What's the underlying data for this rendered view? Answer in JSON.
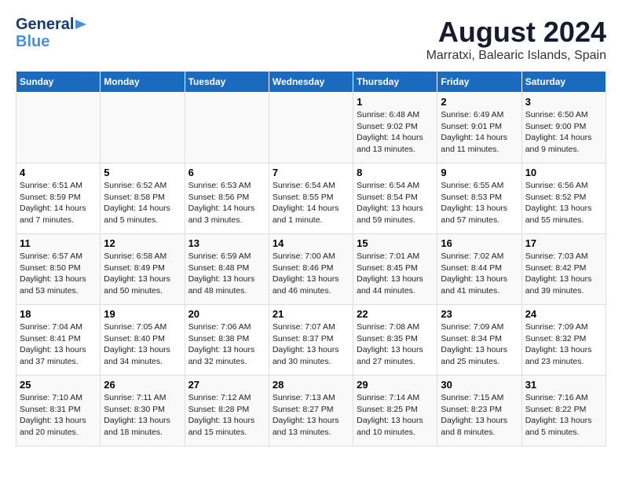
{
  "header": {
    "logo_line1": "General",
    "logo_line2": "Blue",
    "main_title": "August 2024",
    "subtitle": "Marratxi, Balearic Islands, Spain"
  },
  "days_of_week": [
    "Sunday",
    "Monday",
    "Tuesday",
    "Wednesday",
    "Thursday",
    "Friday",
    "Saturday"
  ],
  "weeks": [
    [
      {
        "day": "",
        "info": ""
      },
      {
        "day": "",
        "info": ""
      },
      {
        "day": "",
        "info": ""
      },
      {
        "day": "",
        "info": ""
      },
      {
        "day": "1",
        "info": "Sunrise: 6:48 AM\nSunset: 9:02 PM\nDaylight: 14 hours\nand 13 minutes."
      },
      {
        "day": "2",
        "info": "Sunrise: 6:49 AM\nSunset: 9:01 PM\nDaylight: 14 hours\nand 11 minutes."
      },
      {
        "day": "3",
        "info": "Sunrise: 6:50 AM\nSunset: 9:00 PM\nDaylight: 14 hours\nand 9 minutes."
      }
    ],
    [
      {
        "day": "4",
        "info": "Sunrise: 6:51 AM\nSunset: 8:59 PM\nDaylight: 14 hours\nand 7 minutes."
      },
      {
        "day": "5",
        "info": "Sunrise: 6:52 AM\nSunset: 8:58 PM\nDaylight: 14 hours\nand 5 minutes."
      },
      {
        "day": "6",
        "info": "Sunrise: 6:53 AM\nSunset: 8:56 PM\nDaylight: 14 hours\nand 3 minutes."
      },
      {
        "day": "7",
        "info": "Sunrise: 6:54 AM\nSunset: 8:55 PM\nDaylight: 14 hours\nand 1 minute."
      },
      {
        "day": "8",
        "info": "Sunrise: 6:54 AM\nSunset: 8:54 PM\nDaylight: 13 hours\nand 59 minutes."
      },
      {
        "day": "9",
        "info": "Sunrise: 6:55 AM\nSunset: 8:53 PM\nDaylight: 13 hours\nand 57 minutes."
      },
      {
        "day": "10",
        "info": "Sunrise: 6:56 AM\nSunset: 8:52 PM\nDaylight: 13 hours\nand 55 minutes."
      }
    ],
    [
      {
        "day": "11",
        "info": "Sunrise: 6:57 AM\nSunset: 8:50 PM\nDaylight: 13 hours\nand 53 minutes."
      },
      {
        "day": "12",
        "info": "Sunrise: 6:58 AM\nSunset: 8:49 PM\nDaylight: 13 hours\nand 50 minutes."
      },
      {
        "day": "13",
        "info": "Sunrise: 6:59 AM\nSunset: 8:48 PM\nDaylight: 13 hours\nand 48 minutes."
      },
      {
        "day": "14",
        "info": "Sunrise: 7:00 AM\nSunset: 8:46 PM\nDaylight: 13 hours\nand 46 minutes."
      },
      {
        "day": "15",
        "info": "Sunrise: 7:01 AM\nSunset: 8:45 PM\nDaylight: 13 hours\nand 44 minutes."
      },
      {
        "day": "16",
        "info": "Sunrise: 7:02 AM\nSunset: 8:44 PM\nDaylight: 13 hours\nand 41 minutes."
      },
      {
        "day": "17",
        "info": "Sunrise: 7:03 AM\nSunset: 8:42 PM\nDaylight: 13 hours\nand 39 minutes."
      }
    ],
    [
      {
        "day": "18",
        "info": "Sunrise: 7:04 AM\nSunset: 8:41 PM\nDaylight: 13 hours\nand 37 minutes."
      },
      {
        "day": "19",
        "info": "Sunrise: 7:05 AM\nSunset: 8:40 PM\nDaylight: 13 hours\nand 34 minutes."
      },
      {
        "day": "20",
        "info": "Sunrise: 7:06 AM\nSunset: 8:38 PM\nDaylight: 13 hours\nand 32 minutes."
      },
      {
        "day": "21",
        "info": "Sunrise: 7:07 AM\nSunset: 8:37 PM\nDaylight: 13 hours\nand 30 minutes."
      },
      {
        "day": "22",
        "info": "Sunrise: 7:08 AM\nSunset: 8:35 PM\nDaylight: 13 hours\nand 27 minutes."
      },
      {
        "day": "23",
        "info": "Sunrise: 7:09 AM\nSunset: 8:34 PM\nDaylight: 13 hours\nand 25 minutes."
      },
      {
        "day": "24",
        "info": "Sunrise: 7:09 AM\nSunset: 8:32 PM\nDaylight: 13 hours\nand 23 minutes."
      }
    ],
    [
      {
        "day": "25",
        "info": "Sunrise: 7:10 AM\nSunset: 8:31 PM\nDaylight: 13 hours\nand 20 minutes."
      },
      {
        "day": "26",
        "info": "Sunrise: 7:11 AM\nSunset: 8:30 PM\nDaylight: 13 hours\nand 18 minutes."
      },
      {
        "day": "27",
        "info": "Sunrise: 7:12 AM\nSunset: 8:28 PM\nDaylight: 13 hours\nand 15 minutes."
      },
      {
        "day": "28",
        "info": "Sunrise: 7:13 AM\nSunset: 8:27 PM\nDaylight: 13 hours\nand 13 minutes."
      },
      {
        "day": "29",
        "info": "Sunrise: 7:14 AM\nSunset: 8:25 PM\nDaylight: 13 hours\nand 10 minutes."
      },
      {
        "day": "30",
        "info": "Sunrise: 7:15 AM\nSunset: 8:23 PM\nDaylight: 13 hours\nand 8 minutes."
      },
      {
        "day": "31",
        "info": "Sunrise: 7:16 AM\nSunset: 8:22 PM\nDaylight: 13 hours\nand 5 minutes."
      }
    ]
  ]
}
